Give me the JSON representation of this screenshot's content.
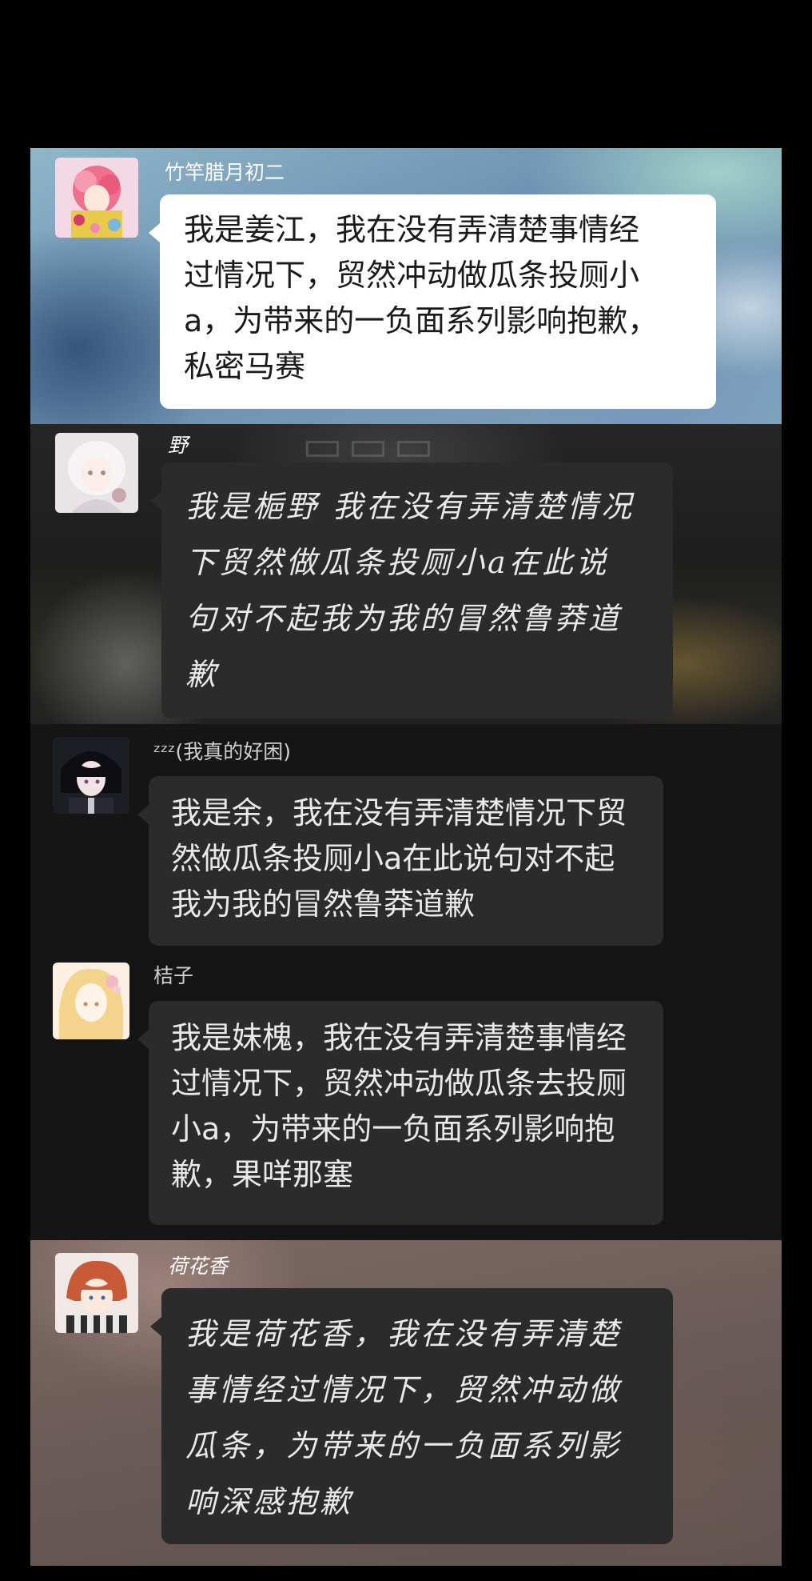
{
  "messages": [
    {
      "sender": "竹竿腊月初二",
      "text": "我是姜江，我在没有弄清楚事情经\n过情况下，贸然冲动做瓜条投厕小\na，为带来的一负面系列影响抱歉，\n私密马赛",
      "avatar_icon": "pink-hair-character-avatar-icon"
    },
    {
      "sender": "野",
      "text": "我是梔野 我在没有弄清楚情况\n下贸然做瓜条投厕小a在此说\n句对不起我为我的冒然鲁莽道\n歉",
      "avatar_icon": "white-hair-character-avatar-icon"
    },
    {
      "sender": "ᶻᶻᶻ(我真的好困)",
      "text": "我是余，我在没有弄清楚情况下贸\n然做瓜条投厕小a在此说句对不起\n我为我的冒然鲁莽道歉",
      "avatar_icon": "dark-hair-character-avatar-icon"
    },
    {
      "sender": "桔子",
      "text": "我是妹槐，我在没有弄清楚事情经\n过情况下，贸然冲动做瓜条去投厕\n小a，为带来的一负面系列影响抱\n歉，果咩那塞",
      "avatar_icon": "blonde-hair-character-avatar-icon"
    },
    {
      "sender": "荷花香",
      "text": "我是荷花香，我在没有弄清楚\n事情经过情况下，贸然冲动做\n瓜条，为带来的一负面系列影\n响深感抱歉",
      "avatar_icon": "red-hair-character-avatar-icon"
    }
  ],
  "colors": {
    "page_background": "#000000",
    "light_bubble": "#ffffff",
    "dark_bubble": "#2b2b2b",
    "light_text": "#e9e9e9",
    "dark_text": "#1a1a1a"
  }
}
